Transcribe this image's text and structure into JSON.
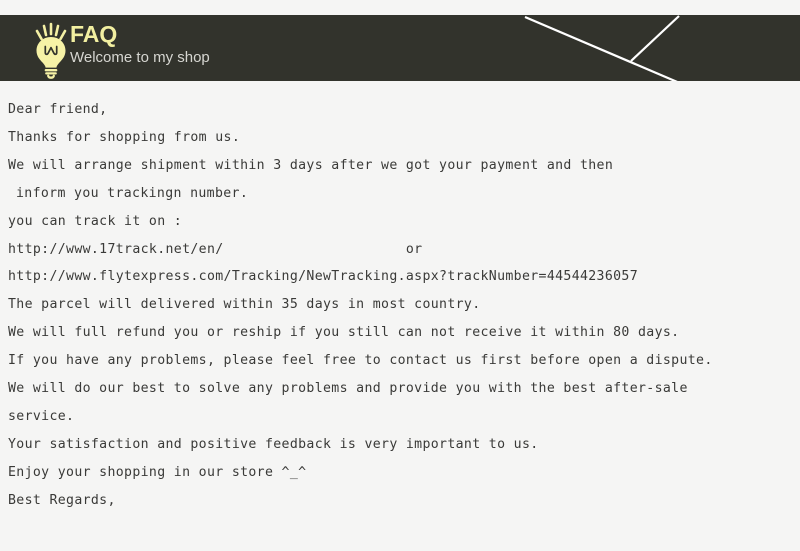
{
  "header": {
    "title": "FAQ",
    "subtitle": "Welcome to my shop",
    "icon": "lightbulb-icon",
    "background_color": "#32332c",
    "title_color": "#f2efa1",
    "subtitle_color": "#d6d6d1",
    "decoration": "diagonal-lines"
  },
  "page": {
    "background_color": "#f5f5f4",
    "text_color": "#3a3a38"
  },
  "body": {
    "lines": [
      {
        "text": "Dear friend,",
        "indent": false
      },
      {
        "text": "Thanks for shopping from us.",
        "indent": false
      },
      {
        "text": "We will arrange shipment within 3 days after we got your payment and then",
        "indent": false
      },
      {
        "text": "inform you trackingn number.",
        "indent": true
      },
      {
        "text": "you can track it on :",
        "indent": false
      },
      {
        "text": "http://www.17track.net/en/                      or",
        "indent": false
      },
      {
        "text": "http://www.flytexpress.com/Tracking/NewTracking.aspx?trackNumber=44544236057",
        "indent": false
      },
      {
        "text": "The parcel will delivered within 35 days in most country.",
        "indent": false
      },
      {
        "text": "We will full refund you or reship if you still can not receive it within 80 days.",
        "indent": false
      },
      {
        "text": "If you have any problems, please feel free to contact us first before open a dispute.",
        "indent": false
      },
      {
        "text": "We will do our best to solve any problems and provide you with the best after-sale",
        "indent": false
      },
      {
        "text": "service.",
        "indent": false
      },
      {
        "text": "Your satisfaction and positive feedback is very important to us.",
        "indent": false
      },
      {
        "text": "Enjoy your shopping in our store ^_^",
        "indent": false
      },
      {
        "text": "Best Regards,",
        "indent": false
      }
    ]
  }
}
